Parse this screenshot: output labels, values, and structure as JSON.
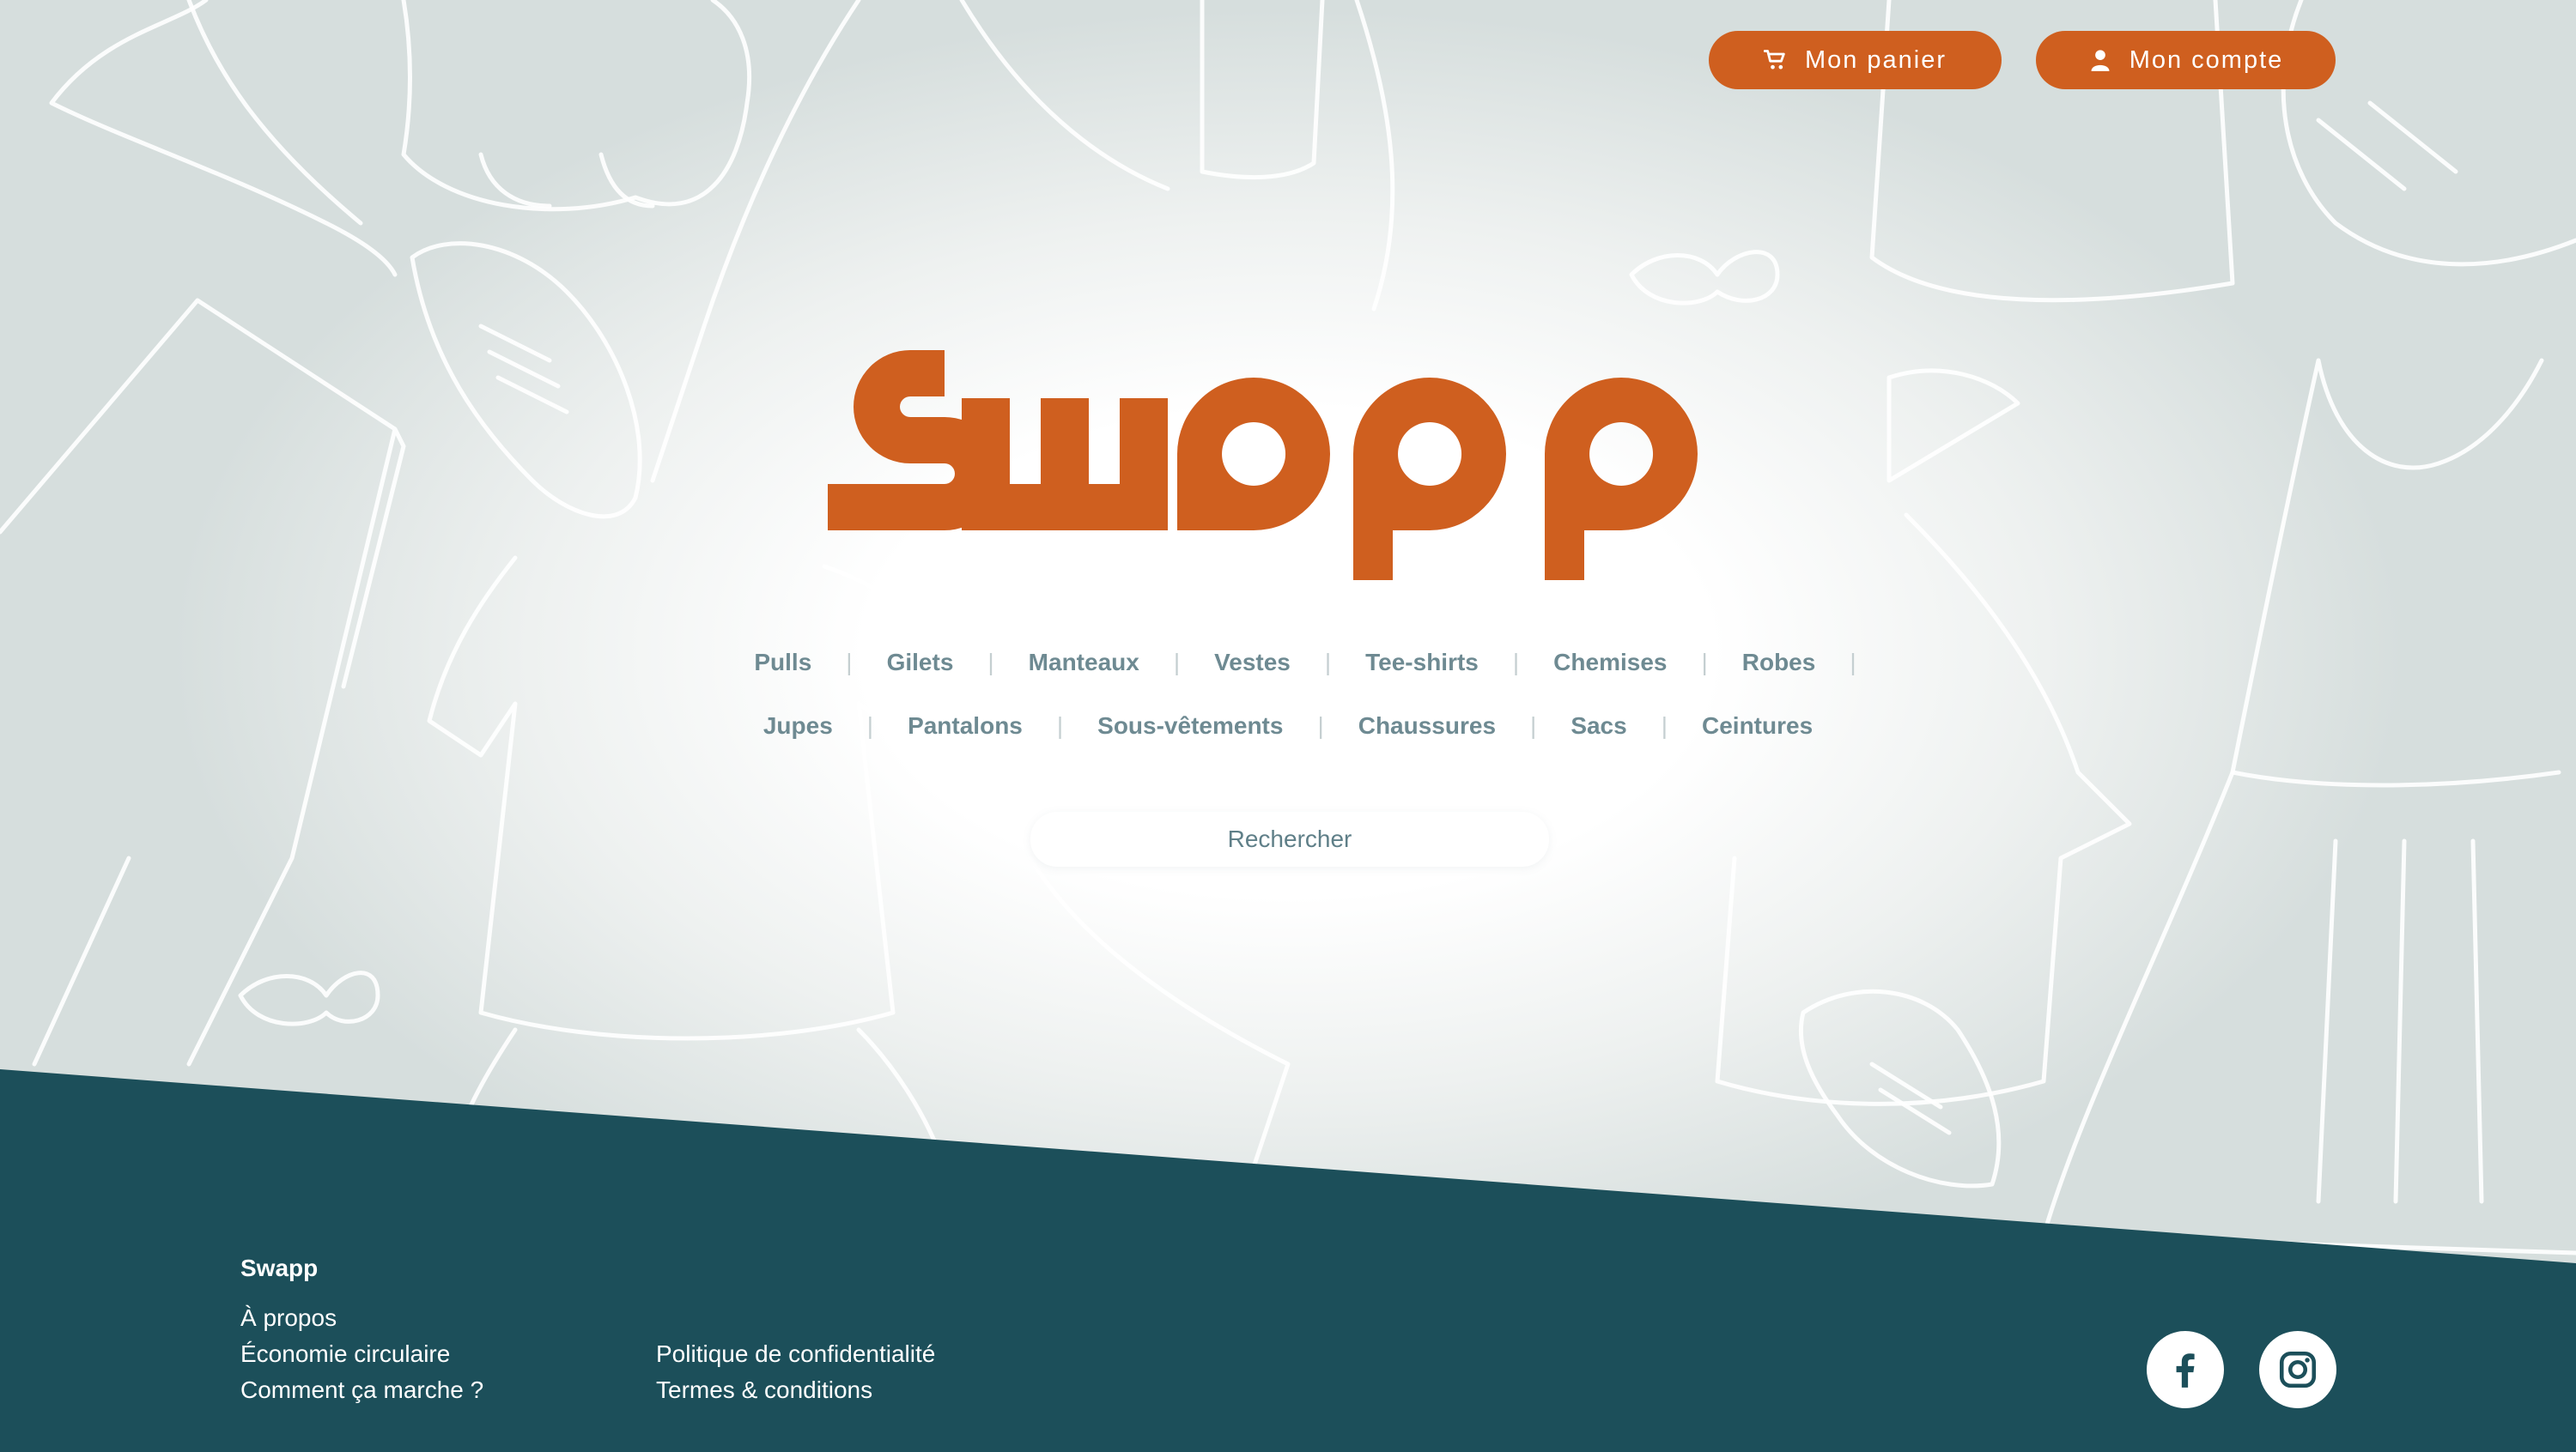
{
  "header": {
    "cart_label": "Mon panier",
    "account_label": "Mon compte"
  },
  "brand": {
    "logo_text": "Swapp",
    "accent_color": "#cf5f1f",
    "footer_color": "#1c4f5a"
  },
  "categories": {
    "row1": [
      "Pulls",
      "Gilets",
      "Manteaux",
      "Vestes",
      "Tee-shirts",
      "Chemises",
      "Robes"
    ],
    "row2": [
      "Jupes",
      "Pantalons",
      "Sous-vêtements",
      "Chaussures",
      "Sacs",
      "Ceintures"
    ]
  },
  "search": {
    "placeholder": "Rechercher"
  },
  "footer": {
    "brand": "Swapp",
    "col1": [
      "À propos",
      "Économie circulaire",
      "Comment ça marche ?"
    ],
    "col2": [
      "Politique de confidentialité",
      "Termes & conditions"
    ],
    "social": [
      "facebook-icon",
      "instagram-icon"
    ]
  }
}
